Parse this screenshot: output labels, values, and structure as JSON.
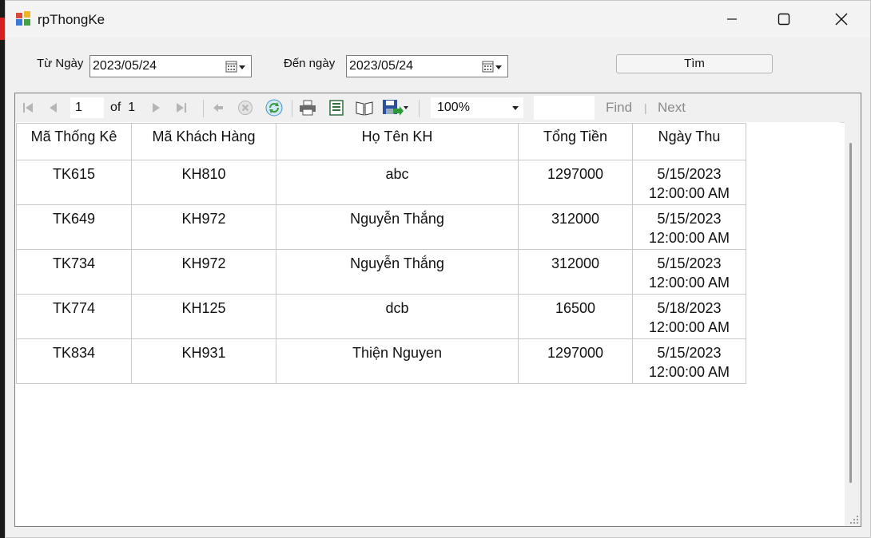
{
  "window": {
    "title": "rpThongKe"
  },
  "filter": {
    "from_label": "Từ Ngày",
    "from_value": "2023/05/24",
    "to_label": "Đến ngày",
    "to_value": "2023/05/24",
    "search_button": "Tìm"
  },
  "toolbar": {
    "page_current": "1",
    "of_label": "of",
    "page_total": "1",
    "zoom": "100%",
    "find_label": "Find",
    "separator": "|",
    "next_label": "Next",
    "icons": [
      "first-page-icon",
      "previous-page-icon",
      "next-page-icon",
      "last-page-icon",
      "back-icon",
      "stop-icon",
      "refresh-icon",
      "print-icon",
      "print-layout-icon",
      "page-setup-icon",
      "export-icon"
    ]
  },
  "report": {
    "columns": [
      "Mã Thống Kê",
      "Mã Khách Hàng",
      "Họ Tên KH",
      "Tổng Tiền",
      "Ngày Thu"
    ],
    "rows": [
      {
        "ma_tk": "TK615",
        "ma_kh": "KH810",
        "ho_ten": "abc",
        "tong_tien": "1297000",
        "ngay": "5/15/2023",
        "gio": "12:00:00 AM"
      },
      {
        "ma_tk": "TK649",
        "ma_kh": "KH972",
        "ho_ten": "Nguyễn Thắng",
        "tong_tien": "312000",
        "ngay": "5/15/2023",
        "gio": "12:00:00 AM"
      },
      {
        "ma_tk": "TK734",
        "ma_kh": "KH972",
        "ho_ten": "Nguyễn Thắng",
        "tong_tien": "312000",
        "ngay": "5/15/2023",
        "gio": "12:00:00 AM"
      },
      {
        "ma_tk": "TK774",
        "ma_kh": "KH125",
        "ho_ten": "dcb",
        "tong_tien": "16500",
        "ngay": "5/18/2023",
        "gio": "12:00:00 AM"
      },
      {
        "ma_tk": "TK834",
        "ma_kh": "KH931",
        "ho_ten": "Thiện Nguyen",
        "tong_tien": "1297000",
        "ngay": "5/15/2023",
        "gio": "12:00:00 AM"
      }
    ]
  }
}
